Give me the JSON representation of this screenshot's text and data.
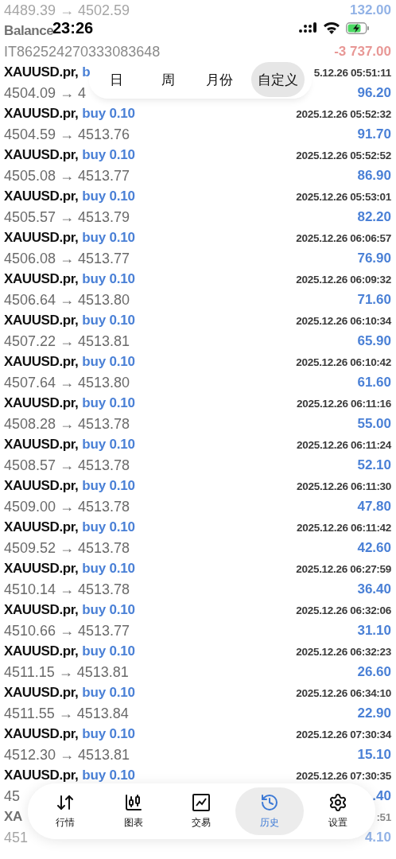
{
  "status_bar": {
    "time": "23:26"
  },
  "period_tabs": [
    {
      "label": "日",
      "selected": false
    },
    {
      "label": "周",
      "selected": false
    },
    {
      "label": "月份",
      "selected": false
    },
    {
      "label": "自定义",
      "selected": true
    }
  ],
  "deals": [
    {
      "kind": "tail",
      "dimmed": true,
      "prices": "4489.39 → 4502.59",
      "amount": "132.00"
    },
    {
      "kind": "balance",
      "dimmed": true,
      "symbol": "Balance",
      "comment": "IT862524270333083648",
      "amount": "-3 737.00"
    },
    {
      "kind": "trade",
      "dimmed": false,
      "symbol": "XAUUSD.pr,",
      "order": "b",
      "time": "5.12.26 05:51:11",
      "prices": "4504.09 → 4",
      "amount": "96.20"
    },
    {
      "kind": "trade",
      "dimmed": false,
      "symbol": "XAUUSD.pr,",
      "order": "buy 0.10",
      "time": "2025.12.26 05:52:32",
      "prices": "4504.59 → 4513.76",
      "amount": "91.70"
    },
    {
      "kind": "trade",
      "dimmed": false,
      "symbol": "XAUUSD.pr,",
      "order": "buy 0.10",
      "time": "2025.12.26 05:52:52",
      "prices": "4505.08 → 4513.77",
      "amount": "86.90"
    },
    {
      "kind": "trade",
      "dimmed": false,
      "symbol": "XAUUSD.pr,",
      "order": "buy 0.10",
      "time": "2025.12.26 05:53:01",
      "prices": "4505.57 → 4513.79",
      "amount": "82.20"
    },
    {
      "kind": "trade",
      "dimmed": false,
      "symbol": "XAUUSD.pr,",
      "order": "buy 0.10",
      "time": "2025.12.26 06:06:57",
      "prices": "4506.08 → 4513.77",
      "amount": "76.90"
    },
    {
      "kind": "trade",
      "dimmed": false,
      "symbol": "XAUUSD.pr,",
      "order": "buy 0.10",
      "time": "2025.12.26 06:09:32",
      "prices": "4506.64 → 4513.80",
      "amount": "71.60"
    },
    {
      "kind": "trade",
      "dimmed": false,
      "symbol": "XAUUSD.pr,",
      "order": "buy 0.10",
      "time": "2025.12.26 06:10:34",
      "prices": "4507.22 → 4513.81",
      "amount": "65.90"
    },
    {
      "kind": "trade",
      "dimmed": false,
      "symbol": "XAUUSD.pr,",
      "order": "buy 0.10",
      "time": "2025.12.26 06:10:42",
      "prices": "4507.64 → 4513.80",
      "amount": "61.60"
    },
    {
      "kind": "trade",
      "dimmed": false,
      "symbol": "XAUUSD.pr,",
      "order": "buy 0.10",
      "time": "2025.12.26 06:11:16",
      "prices": "4508.28 → 4513.78",
      "amount": "55.00"
    },
    {
      "kind": "trade",
      "dimmed": false,
      "symbol": "XAUUSD.pr,",
      "order": "buy 0.10",
      "time": "2025.12.26 06:11:24",
      "prices": "4508.57 → 4513.78",
      "amount": "52.10"
    },
    {
      "kind": "trade",
      "dimmed": false,
      "symbol": "XAUUSD.pr,",
      "order": "buy 0.10",
      "time": "2025.12.26 06:11:30",
      "prices": "4509.00 → 4513.78",
      "amount": "47.80"
    },
    {
      "kind": "trade",
      "dimmed": false,
      "symbol": "XAUUSD.pr,",
      "order": "buy 0.10",
      "time": "2025.12.26 06:11:42",
      "prices": "4509.52 → 4513.78",
      "amount": "42.60"
    },
    {
      "kind": "trade",
      "dimmed": false,
      "symbol": "XAUUSD.pr,",
      "order": "buy 0.10",
      "time": "2025.12.26 06:27:59",
      "prices": "4510.14 → 4513.78",
      "amount": "36.40"
    },
    {
      "kind": "trade",
      "dimmed": false,
      "symbol": "XAUUSD.pr,",
      "order": "buy 0.10",
      "time": "2025.12.26 06:32:06",
      "prices": "4510.66 → 4513.77",
      "amount": "31.10"
    },
    {
      "kind": "trade",
      "dimmed": false,
      "symbol": "XAUUSD.pr,",
      "order": "buy 0.10",
      "time": "2025.12.26 06:32:23",
      "prices": "4511.15 → 4513.81",
      "amount": "26.60"
    },
    {
      "kind": "trade",
      "dimmed": false,
      "symbol": "XAUUSD.pr,",
      "order": "buy 0.10",
      "time": "2025.12.26 06:34:10",
      "prices": "4511.55 → 4513.84",
      "amount": "22.90"
    },
    {
      "kind": "trade",
      "dimmed": false,
      "symbol": "XAUUSD.pr,",
      "order": "buy 0.10",
      "time": "2025.12.26 07:30:34",
      "prices": "4512.30 → 4513.81",
      "amount": "15.10"
    },
    {
      "kind": "trade",
      "dimmed": false,
      "symbol": "XAUUSD.pr,",
      "order": "buy 0.10",
      "time": "2025.12.26 07:30:35",
      "prices": "45",
      "amount": ".40"
    },
    {
      "kind": "trade",
      "dimmed": true,
      "symbol": "XA",
      "time": ":51",
      "prices": "451",
      "amount": "4.10"
    }
  ],
  "nav": [
    {
      "label": "行情",
      "selected": false
    },
    {
      "label": "图表",
      "selected": false
    },
    {
      "label": "交易",
      "selected": false
    },
    {
      "label": "历史",
      "selected": true
    },
    {
      "label": "设置",
      "selected": false
    }
  ]
}
